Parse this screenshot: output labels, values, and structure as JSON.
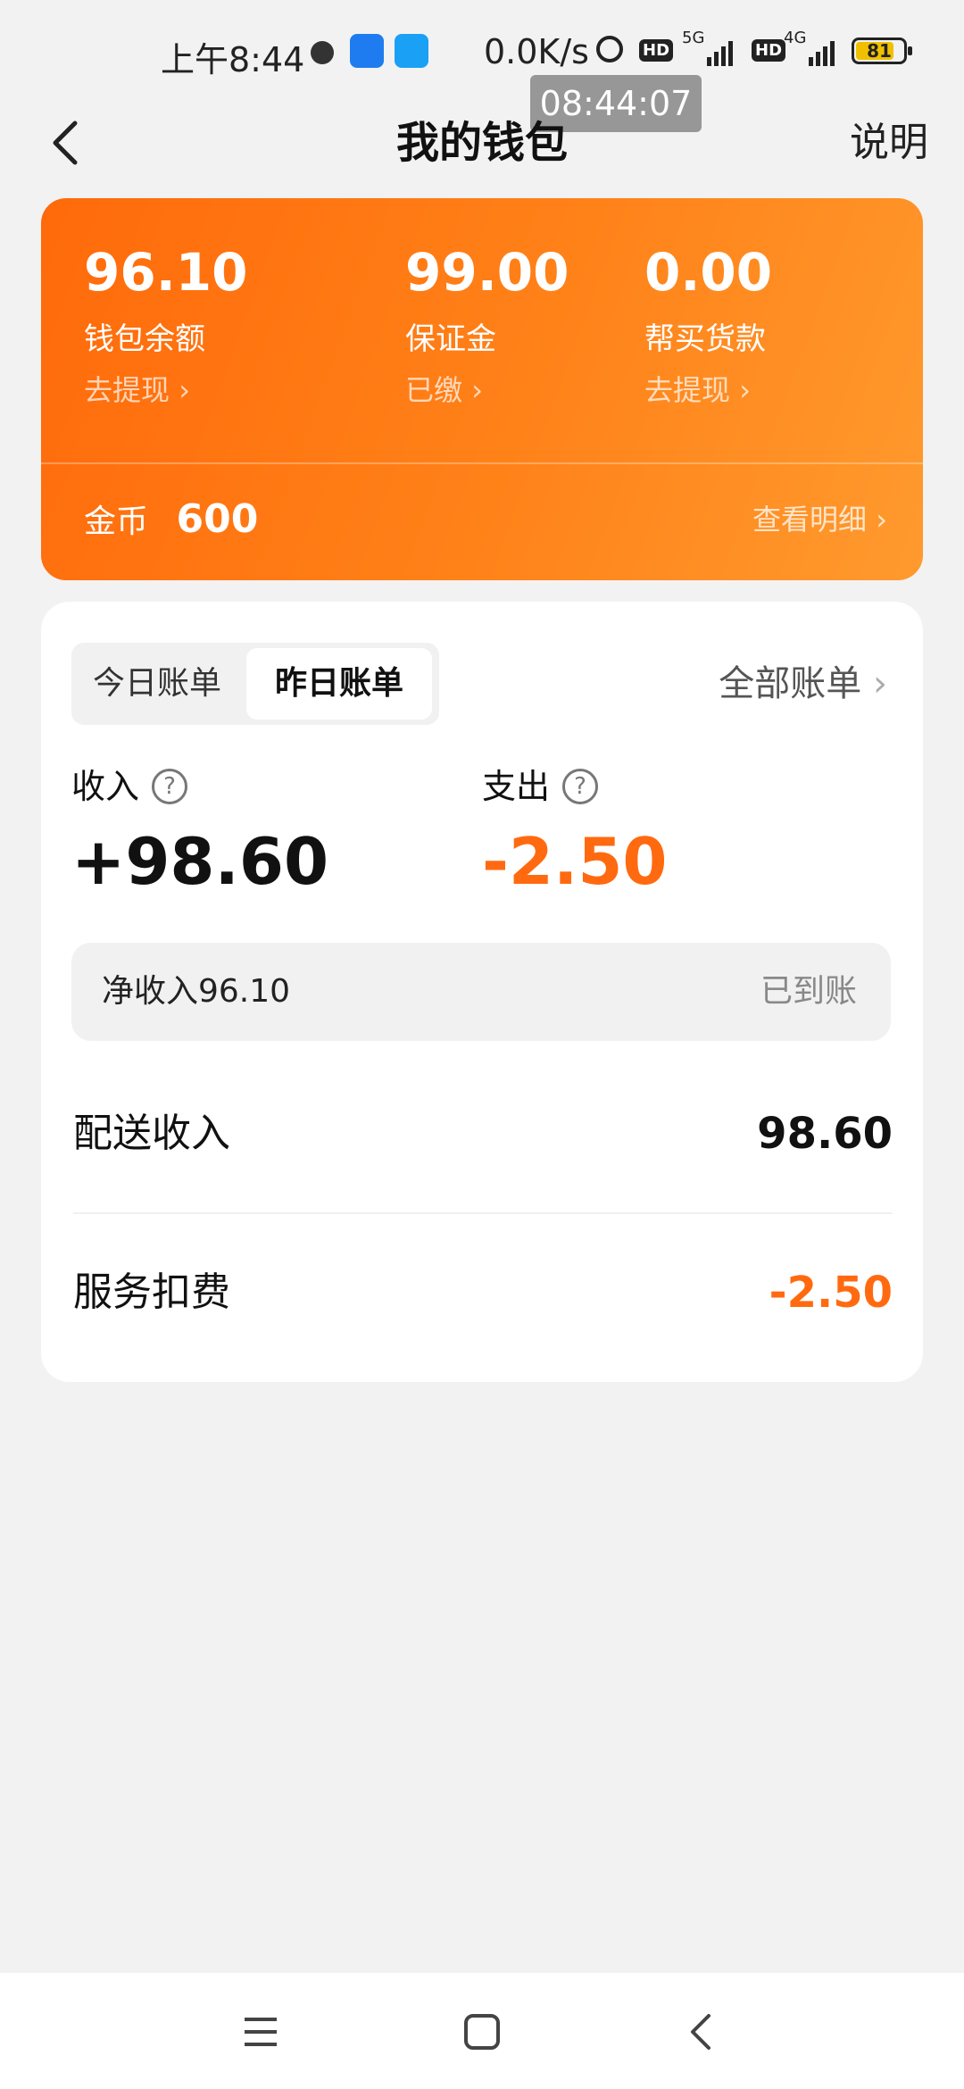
{
  "status_bar": {
    "time": "上午8:44",
    "speed": "0.0K/s",
    "hd": "HD",
    "net1": "5G",
    "net2": "4G",
    "battery": "81",
    "battery_level": 0.81
  },
  "time_overlay": "08:44:07",
  "nav": {
    "title": "我的钱包",
    "explain": "说明"
  },
  "wallet": {
    "balance": {
      "amount": "96.10",
      "label": "钱包余额",
      "action": "去提现"
    },
    "deposit": {
      "amount": "99.00",
      "label": "保证金",
      "action": "已缴"
    },
    "purchase": {
      "amount": "0.00",
      "label": "帮买货款",
      "action": "去提现"
    },
    "coin_label": "金币",
    "coin_value": "600",
    "detail_link": "查看明细"
  },
  "bills": {
    "tab_today": "今日账单",
    "tab_yesterday": "昨日账单",
    "all_bills": "全部账单",
    "income_label": "收入",
    "income_value": "+98.60",
    "expense_label": "支出",
    "expense_value": "-2.50",
    "net_label": "净收入96.10",
    "net_status": "已到账",
    "items": [
      {
        "name": "配送收入",
        "value": "98.60"
      },
      {
        "name": "服务扣费",
        "value": "-2.50"
      }
    ]
  },
  "colors": {
    "accent": "#ff6a10",
    "card_start": "#ff6a0a",
    "card_end": "#ff9a2e"
  }
}
